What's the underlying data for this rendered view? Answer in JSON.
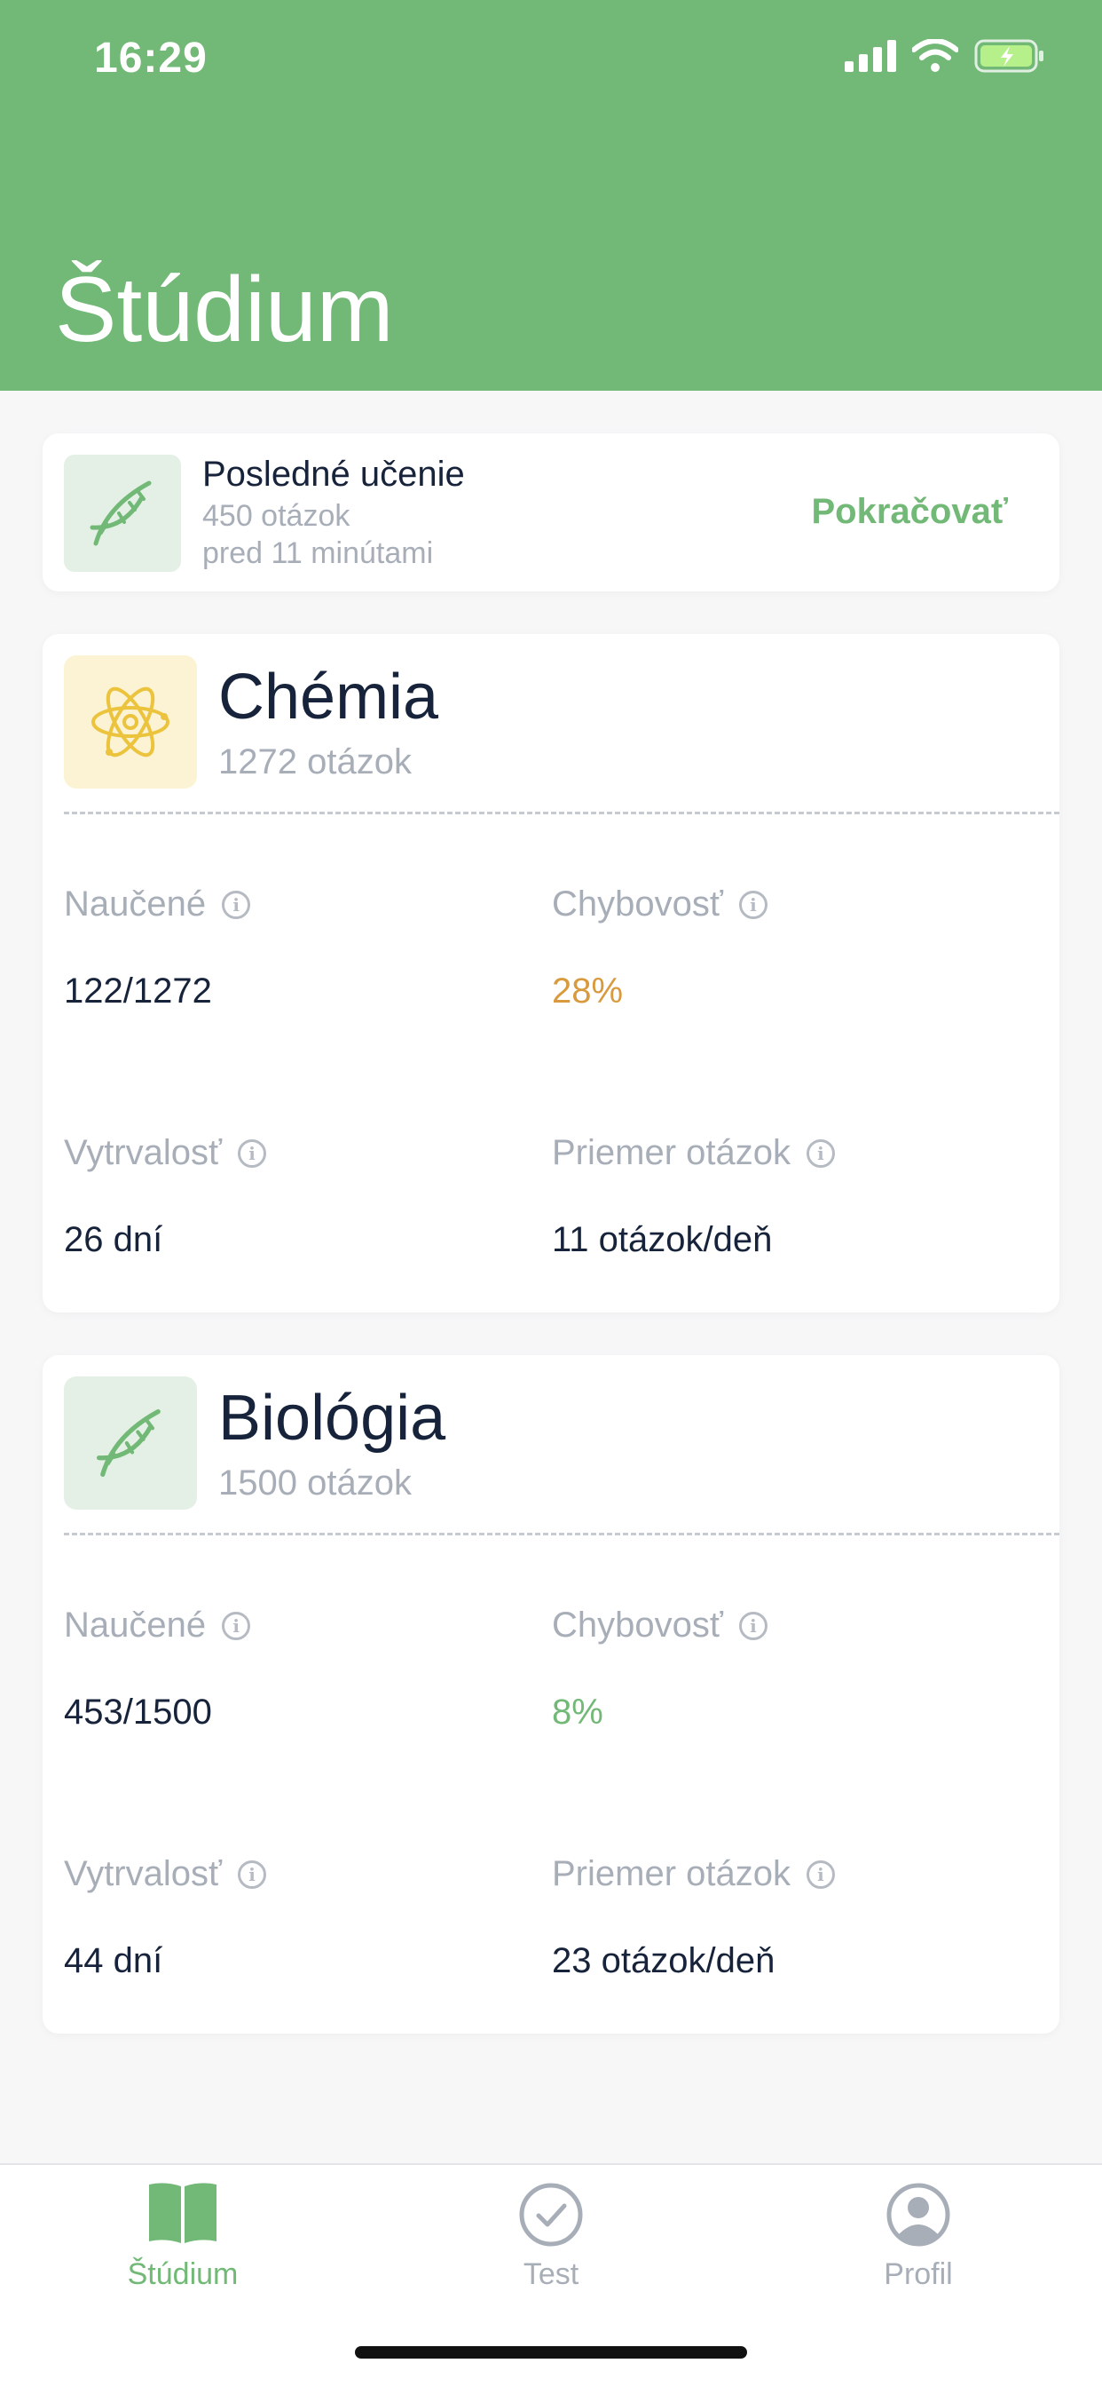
{
  "status_bar": {
    "time": "16:29"
  },
  "header": {
    "title": "Štúdium"
  },
  "recent": {
    "title": "Posledné učenie",
    "count": "450 otázok",
    "time_ago": "pred 11 minútami",
    "action": "Pokračovať",
    "icon": "dna-icon"
  },
  "subjects": [
    {
      "name": "Chémia",
      "count": "1272 otázok",
      "icon": "atom-icon",
      "stats": {
        "learned_label": "Naučené",
        "learned_value": "122/1272",
        "error_label": "Chybovosť",
        "error_value": "28%",
        "error_color": "#d89a3c",
        "streak_label": "Vytrvalosť",
        "streak_value": "26 dní",
        "avg_label": "Priemer otázok",
        "avg_value": "11 otázok/deň"
      }
    },
    {
      "name": "Biológia",
      "count": "1500 otázok",
      "icon": "dna-icon",
      "stats": {
        "learned_label": "Naučené",
        "learned_value": "453/1500",
        "error_label": "Chybovosť",
        "error_value": "8%",
        "error_color": "#72b977",
        "streak_label": "Vytrvalosť",
        "streak_value": "44 dní",
        "avg_label": "Priemer otázok",
        "avg_value": "23 otázok/deň"
      }
    }
  ],
  "tabs": [
    {
      "label": "Štúdium",
      "icon": "book-icon",
      "active": true
    },
    {
      "label": "Test",
      "icon": "check-circle-icon",
      "active": false
    },
    {
      "label": "Profil",
      "icon": "profile-icon",
      "active": false
    }
  ],
  "colors": {
    "brand": "#72b977",
    "warning": "#d89a3c"
  }
}
